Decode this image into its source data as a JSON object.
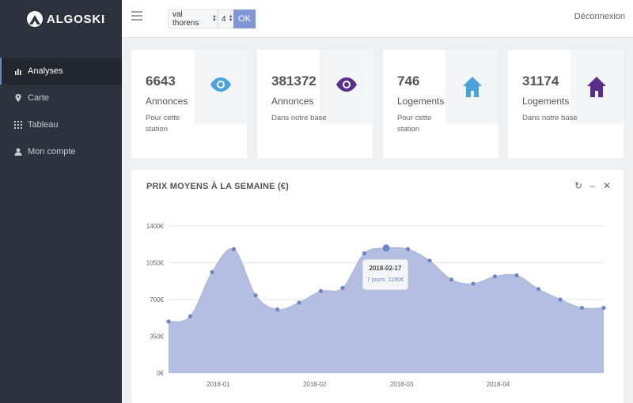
{
  "brand": {
    "name": "ALGOSKI"
  },
  "sidebar": {
    "items": [
      {
        "label": "Analyses",
        "icon": "bar-chart-icon",
        "active": true
      },
      {
        "label": "Carte",
        "icon": "map-pin-icon",
        "active": false
      },
      {
        "label": "Tableau",
        "icon": "grid-icon",
        "active": false
      },
      {
        "label": "Mon compte",
        "icon": "user-icon",
        "active": false
      }
    ]
  },
  "topbar": {
    "station_value": "val thorens",
    "number_value": "4",
    "ok_label": "OK",
    "logout_label": "Déconnexion"
  },
  "cards": [
    {
      "value": "6643",
      "label": "Annonces",
      "desc": "Pour cette station",
      "icon": "eye-icon",
      "color": "#4aa3df"
    },
    {
      "value": "381372",
      "label": "Annonces",
      "desc": "Dans notre base",
      "icon": "eye-icon",
      "color": "#5b2d8e"
    },
    {
      "value": "746",
      "label": "Logements",
      "desc": "Pour cette station",
      "icon": "home-icon",
      "color": "#4aa3df"
    },
    {
      "value": "31174",
      "label": "Logements",
      "desc": "Dans notre base",
      "icon": "home-icon",
      "color": "#5b2d8e"
    }
  ],
  "panel": {
    "title": "PRIX MOYENS À LA SEMAINE (€)",
    "tools": [
      "↻",
      "–",
      "✕"
    ]
  },
  "tooltip": {
    "date": "2018-02-17",
    "text": "7 jours: 1190€"
  },
  "chart_data": {
    "type": "area",
    "title": "PRIX MOYENS À LA SEMAINE (€)",
    "x": [
      "2017-12-16",
      "2017-12-23",
      "2017-12-30",
      "2018-01-06",
      "2018-01-13",
      "2018-01-20",
      "2018-01-27",
      "2018-02-03",
      "2018-02-10",
      "2018-02-17",
      "2018-02-24",
      "2018-03-03",
      "2018-03-10",
      "2018-03-17",
      "2018-03-24",
      "2018-03-31",
      "2018-04-07",
      "2018-04-14",
      "2018-04-21",
      "2018-04-28",
      "2018-05-05"
    ],
    "values": [
      490,
      540,
      960,
      1180,
      740,
      605,
      670,
      780,
      810,
      1140,
      1190,
      1180,
      1070,
      890,
      850,
      920,
      930,
      800,
      700,
      620,
      620
    ],
    "yticks": [
      "0€",
      "350€",
      "700€",
      "1050€",
      "1400€"
    ],
    "ylim": [
      0,
      1400
    ],
    "xticks": [
      "2018-01",
      "2018-02",
      "2018-03",
      "2018-04"
    ],
    "xtick_dates": [
      "2018-01-01",
      "2018-02-01",
      "2018-03-01",
      "2018-04-01"
    ],
    "highlight_index": 10,
    "grid": true,
    "fill_color": "#b4bee0",
    "point_color": "#6f86c6"
  }
}
